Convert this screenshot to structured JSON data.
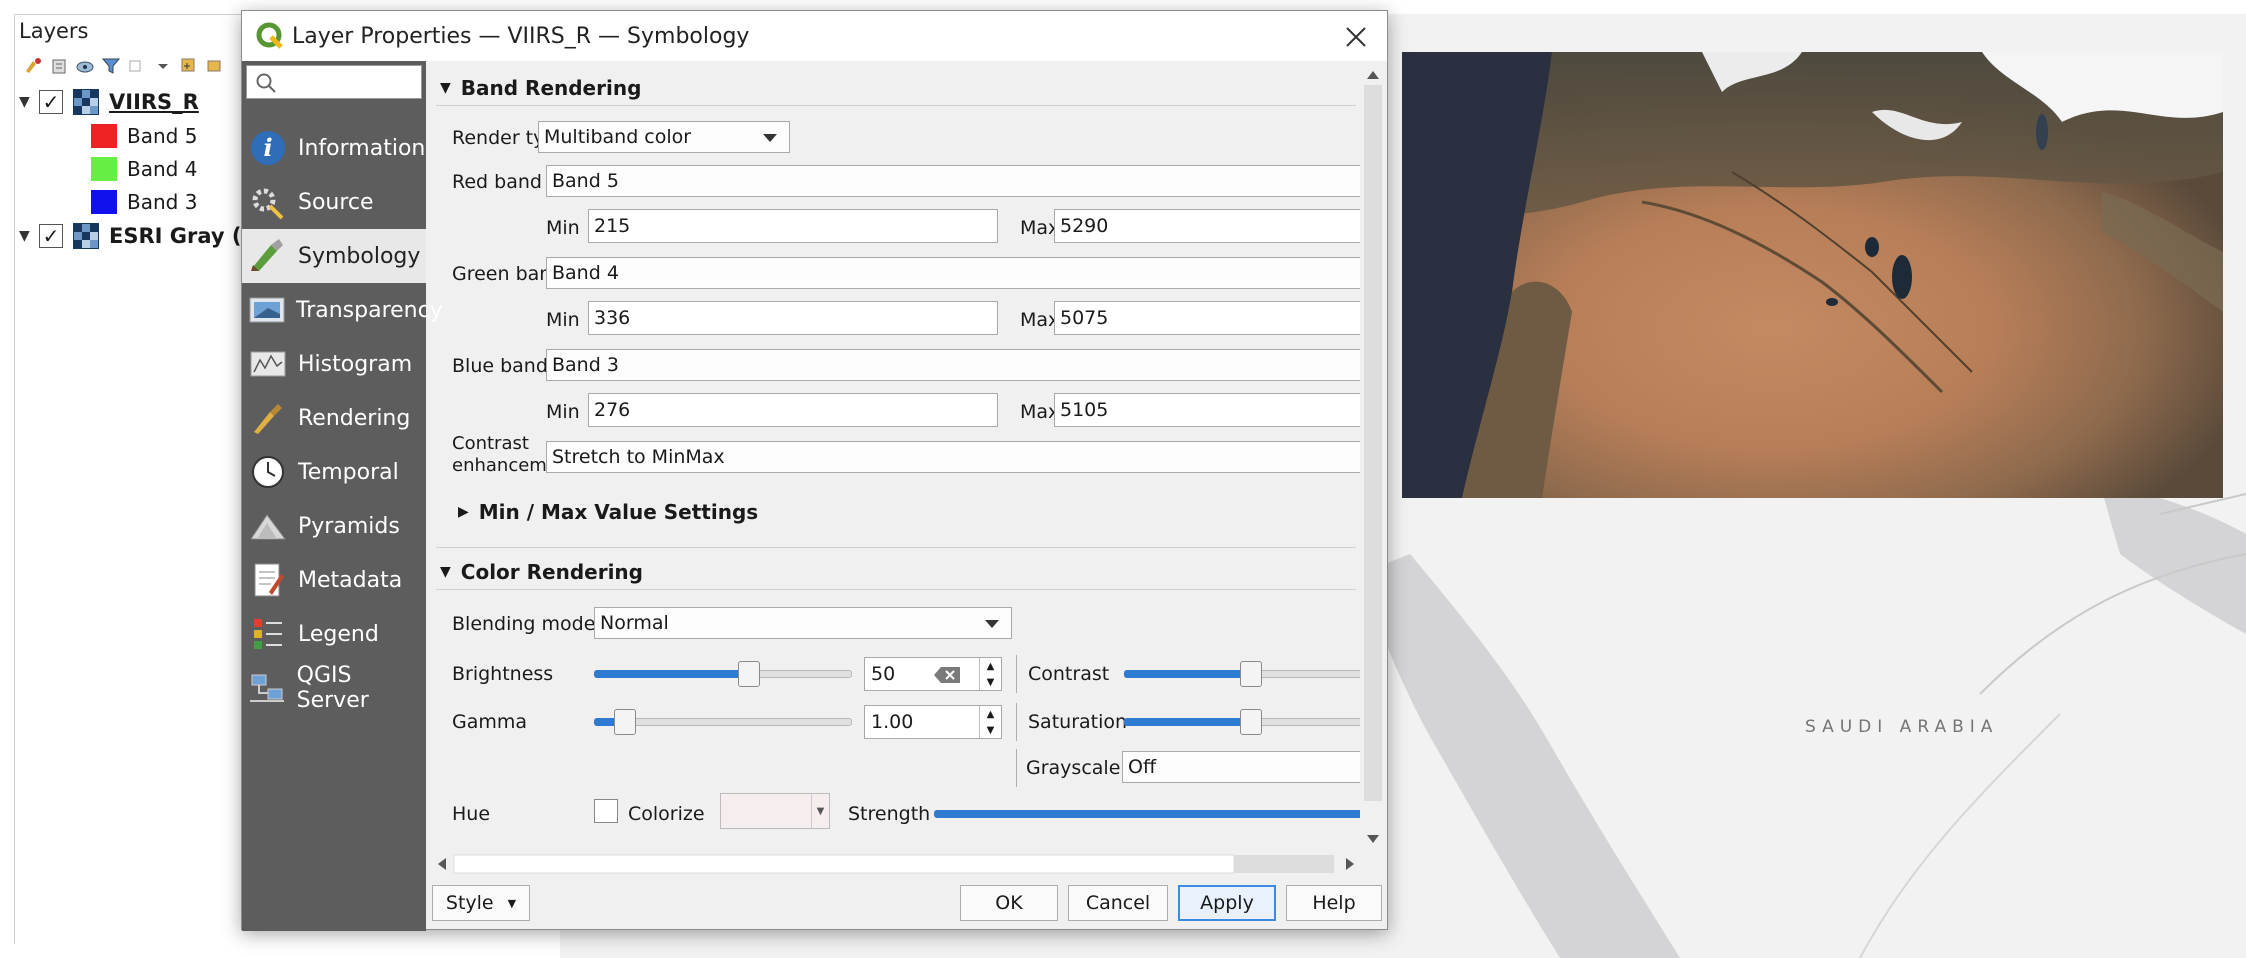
{
  "layers_panel": {
    "title": "Layers",
    "layers": [
      {
        "name": "VIIRS_R",
        "checked": "✓",
        "bands": [
          {
            "label": "Band 5",
            "color": "#ee2222"
          },
          {
            "label": "Band 4",
            "color": "#66ee44"
          },
          {
            "label": "Band 3",
            "color": "#1111ee"
          }
        ]
      },
      {
        "name": "ESRI Gray (",
        "checked": "✓"
      }
    ]
  },
  "map": {
    "country_label": "SAUDI ARABIA",
    "land_color": "#f2f2f2",
    "water_color": "#d4d4d6"
  },
  "dialog": {
    "title": "Layer Properties — VIIRS_R — Symbology",
    "search_placeholder": "",
    "nav": [
      {
        "label": "Information",
        "icon": "information-icon"
      },
      {
        "label": "Source",
        "icon": "source-icon"
      },
      {
        "label": "Symbology",
        "icon": "symbology-icon"
      },
      {
        "label": "Transparency",
        "icon": "transparency-icon"
      },
      {
        "label": "Histogram",
        "icon": "histogram-icon"
      },
      {
        "label": "Rendering",
        "icon": "rendering-icon"
      },
      {
        "label": "Temporal",
        "icon": "temporal-icon"
      },
      {
        "label": "Pyramids",
        "icon": "pyramids-icon"
      },
      {
        "label": "Metadata",
        "icon": "metadata-icon"
      },
      {
        "label": "Legend",
        "icon": "legend-icon"
      },
      {
        "label": "QGIS Server",
        "icon": "qgis-server-icon"
      }
    ],
    "selected_nav": "Symbology",
    "band_rendering": {
      "header": "Band Rendering",
      "render_type_label": "Render type",
      "render_type_value": "Multiband color",
      "red_band_label": "Red band",
      "red_band_value": "Band 5",
      "red_min": "215",
      "red_max": "5290",
      "green_band_label": "Green band",
      "green_band_value": "Band 4",
      "green_min": "336",
      "green_max": "5075",
      "blue_band_label": "Blue band",
      "blue_band_value": "Band 3",
      "blue_min": "276",
      "blue_max": "5105",
      "min_label": "Min",
      "max_label": "Max",
      "contrast_label_1": "Contrast",
      "contrast_label_2": "enhancement",
      "contrast_value": "Stretch to MinMax",
      "minmax_header": "Min / Max Value Settings"
    },
    "color_rendering": {
      "header": "Color Rendering",
      "blending_label": "Blending mode",
      "blending_value": "Normal",
      "brightness_label": "Brightness",
      "brightness_value": "50",
      "brightness_level": 0.6,
      "contrast_label": "Contrast",
      "contrast_level": 0.5,
      "gamma_label": "Gamma",
      "gamma_value": "1.00",
      "gamma_level": 0.12,
      "saturation_label": "Saturation",
      "saturation_level": 0.5,
      "grayscale_label": "Grayscale",
      "grayscale_value": "Off",
      "hue_label": "Hue",
      "colorize_label": "Colorize",
      "strength_label": "Strength"
    },
    "buttons": {
      "style": "Style",
      "ok": "OK",
      "cancel": "Cancel",
      "apply": "Apply",
      "help": "Help"
    },
    "accent_color": "#2f7bd2"
  }
}
